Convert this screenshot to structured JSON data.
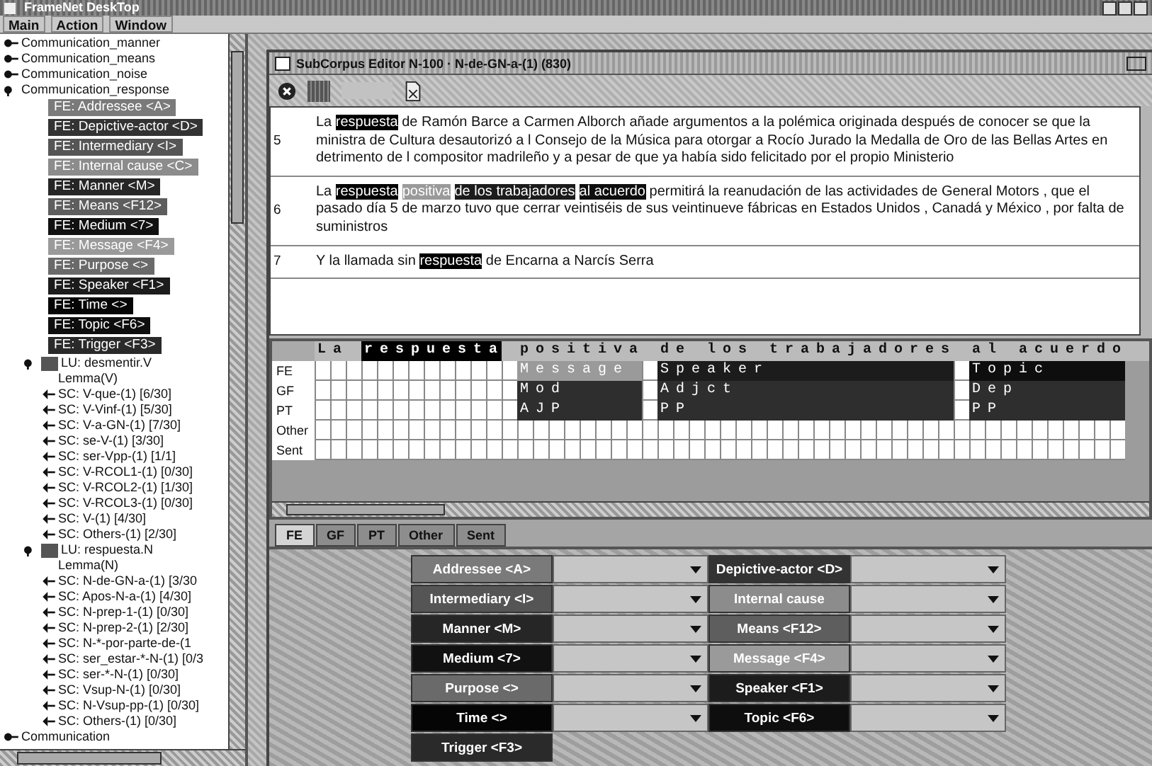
{
  "window": {
    "title": "FrameNet DeskTop"
  },
  "menu": [
    "Main",
    "Action",
    "Window"
  ],
  "tree": [
    {
      "kind": "frame",
      "label": "Communication_manner",
      "expanded": false
    },
    {
      "kind": "frame",
      "label": "Communication_means",
      "expanded": false
    },
    {
      "kind": "frame",
      "label": "Communication_noise",
      "expanded": false
    },
    {
      "kind": "frame",
      "label": "Communication_response",
      "expanded": true,
      "children": [
        {
          "kind": "fe",
          "label": "FE: Addressee <A>",
          "color": "#7a7a7a"
        },
        {
          "kind": "fe",
          "label": "FE: Depictive-actor <D>",
          "color": "#333333"
        },
        {
          "kind": "fe",
          "label": "FE: Intermediary <I>",
          "color": "#555555"
        },
        {
          "kind": "fe",
          "label": "FE: Internal cause <C>",
          "color": "#8c8c8c"
        },
        {
          "kind": "fe",
          "label": "FE: Manner <M>",
          "color": "#262626"
        },
        {
          "kind": "fe",
          "label": "FE: Means <F12>",
          "color": "#5e5e5e"
        },
        {
          "kind": "fe",
          "label": "FE: Medium <7>",
          "color": "#111111"
        },
        {
          "kind": "fe",
          "label": "FE: Message <F4>",
          "color": "#9a9a9a"
        },
        {
          "kind": "fe",
          "label": "FE: Purpose <>",
          "color": "#6a6a6a"
        },
        {
          "kind": "fe",
          "label": "FE: Speaker <F1>",
          "color": "#1c1c1c"
        },
        {
          "kind": "fe",
          "label": "FE: Time <>",
          "color": "#050505"
        },
        {
          "kind": "fe",
          "label": "FE: Topic <F6>",
          "color": "#0e0e0e"
        },
        {
          "kind": "fe",
          "label": "FE: Trigger <F3>",
          "color": "#2a2a2a"
        },
        {
          "kind": "lu",
          "label": "LU: desmentir.V",
          "expanded": true,
          "children": [
            {
              "kind": "lemma",
              "label": "Lemma(V)"
            },
            {
              "kind": "subcorpus",
              "label": "SC: V-que-(1) [6/30]"
            },
            {
              "kind": "subcorpus",
              "label": "SC: V-Vinf-(1) [5/30]"
            },
            {
              "kind": "subcorpus",
              "label": "SC: V-a-GN-(1) [7/30]"
            },
            {
              "kind": "subcorpus",
              "label": "SC: se-V-(1) [3/30]"
            },
            {
              "kind": "subcorpus",
              "label": "SC: ser-Vpp-(1) [1/1]"
            },
            {
              "kind": "subcorpus",
              "label": "SC: V-RCOL1-(1) [0/30]"
            },
            {
              "kind": "subcorpus",
              "label": "SC: V-RCOL2-(1) [1/30]"
            },
            {
              "kind": "subcorpus",
              "label": "SC: V-RCOL3-(1) [0/30]"
            },
            {
              "kind": "subcorpus",
              "label": "SC: V-(1) [4/30]"
            },
            {
              "kind": "subcorpus",
              "label": "SC: Others-(1) [2/30]"
            }
          ]
        },
        {
          "kind": "lu",
          "label": "LU: respuesta.N",
          "expanded": true,
          "children": [
            {
              "kind": "lemma",
              "label": "Lemma(N)"
            },
            {
              "kind": "subcorpus",
              "label": "SC: N-de-GN-a-(1) [3/30"
            },
            {
              "kind": "subcorpus",
              "label": "SC: Apos-N-a-(1) [4/30]"
            },
            {
              "kind": "subcorpus",
              "label": "SC: N-prep-1-(1) [0/30]"
            },
            {
              "kind": "subcorpus",
              "label": "SC: N-prep-2-(1) [2/30]"
            },
            {
              "kind": "subcorpus",
              "label": "SC: N-*-por-parte-de-(1"
            },
            {
              "kind": "subcorpus",
              "label": "SC: ser_estar-*-N-(1) [0/3"
            },
            {
              "kind": "subcorpus",
              "label": "SC: ser-*-N-(1) [0/30]"
            },
            {
              "kind": "subcorpus",
              "label": "SC: Vsup-N-(1) [0/30]"
            },
            {
              "kind": "subcorpus",
              "label": "SC: N-Vsup-pp-(1) [0/30]"
            },
            {
              "kind": "subcorpus",
              "label": "SC: Others-(1) [0/30]"
            }
          ]
        }
      ]
    },
    {
      "kind": "frame",
      "label": "Communication",
      "expanded": false
    }
  ],
  "editor": {
    "title": "SubCorpus Editor N-100 · N-de-GN-a-(1) (830)",
    "sentences": [
      {
        "number": "5",
        "segments": [
          {
            "kind": "text",
            "text": "La "
          },
          {
            "kind": "target",
            "text": "respuesta"
          },
          {
            "kind": "text",
            "text": " de Ramón Barce a Carmen Alborch añade argumentos a la polémica originada después de conocer se que la ministra de Cultura desautorizó a l Consejo de la Música para otorgar a Rocío Jurado la Medalla de Oro de las Bellas Artes en detrimento de l compositor madrileño y a pesar de que ya había sido felicitado por el propio Ministerio"
          }
        ]
      },
      {
        "number": "6",
        "segments": [
          {
            "kind": "text",
            "text": "La "
          },
          {
            "kind": "target",
            "text": "respuesta"
          },
          {
            "kind": "fe",
            "text": "positiva",
            "color": "#9a9a9a"
          },
          {
            "kind": "fe",
            "text": "de los trabajadores",
            "color": "#1c1c1c"
          },
          {
            "kind": "fe",
            "text": "al acuerdo",
            "color": "#0e0e0e"
          },
          {
            "kind": "text",
            "text": " permitirá la reanudación de las actividades de General Motors , que el pasado día 5 de marzo tuvo que cerrar veintiséis de sus veintinueve fábricas en Estados Unidos , Canadá y México , por falta de suministros"
          }
        ]
      },
      {
        "number": "7",
        "segments": [
          {
            "kind": "text",
            "text": "Y la llamada sin "
          },
          {
            "kind": "target",
            "text": "respuesta"
          },
          {
            "kind": "text",
            "text": " de Encarna a Narcís Serra"
          }
        ]
      }
    ],
    "grid": {
      "layers": [
        "FE",
        "GF",
        "PT",
        "Other",
        "Sent"
      ],
      "chunks": [
        {
          "text": "La",
          "target": false
        },
        {
          "text": "respuesta",
          "target": true
        },
        {
          "text": "positiva",
          "target": false,
          "fe": "Message",
          "gf": "Mod",
          "pt": "AJP",
          "color": "#9a9a9a"
        },
        {
          "text": "de los trabajadores",
          "target": false,
          "fe": "Speaker",
          "gf": "Adjct",
          "pt": "PP",
          "color": "#1c1c1c"
        },
        {
          "text": "al acuerdo",
          "target": false,
          "fe": "Topic",
          "gf": "Dep",
          "pt": "PP",
          "color": "#0e0e0e"
        }
      ]
    },
    "tabs": [
      {
        "label": "FE",
        "selected": true
      },
      {
        "label": "GF",
        "selected": false
      },
      {
        "label": "PT",
        "selected": false
      },
      {
        "label": "Other",
        "selected": false
      },
      {
        "label": "Sent",
        "selected": false
      }
    ],
    "fe_buttons": [
      {
        "kind": "select",
        "label": "Addressee <A>",
        "color": "#7a7a7a"
      },
      {
        "kind": "select",
        "label": "Depictive-actor <D>",
        "color": "#333333"
      },
      {
        "kind": "select",
        "label": "Intermediary <I>",
        "color": "#555555"
      },
      {
        "kind": "select",
        "label": "Internal cause",
        "color": "#8c8c8c"
      },
      {
        "kind": "select",
        "label": "Manner <M>",
        "color": "#262626"
      },
      {
        "kind": "select",
        "label": "Means <F12>",
        "color": "#5e5e5e"
      },
      {
        "kind": "select",
        "label": "Medium <7>",
        "color": "#111111"
      },
      {
        "kind": "select",
        "label": "Message <F4>",
        "color": "#9a9a9a"
      },
      {
        "kind": "select",
        "label": "Purpose <>",
        "color": "#6a6a6a"
      },
      {
        "kind": "select",
        "label": "Speaker <F1>",
        "color": "#1c1c1c"
      },
      {
        "kind": "select",
        "label": "Time <>",
        "color": "#050505"
      },
      {
        "kind": "select",
        "label": "Topic <F6>",
        "color": "#0e0e0e"
      },
      {
        "kind": "trigger",
        "label": "Trigger <F3>",
        "color": "#2a2a2a"
      }
    ]
  }
}
